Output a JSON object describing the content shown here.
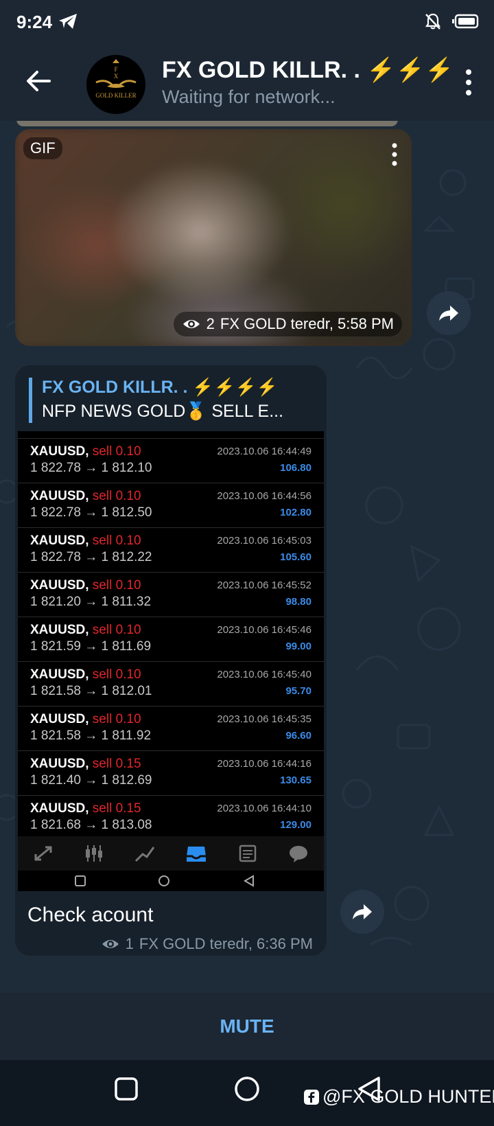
{
  "status_bar": {
    "time": "9:24"
  },
  "header": {
    "title": "FX GOLD KILLR. . ⚡⚡⚡",
    "subtitle": "Waiting for network..."
  },
  "gif_message": {
    "badge": "GIF",
    "views": "2",
    "signature": "FX GOLD teredr, 5:58 PM"
  },
  "post": {
    "reply_title": "FX GOLD KILLR. . ⚡⚡⚡⚡",
    "reply_text": "NFP NEWS   GOLD🥇 SELL  E...",
    "caption": "Check acount",
    "views": "1",
    "signature": "FX GOLD teredr, 6:36 PM",
    "trades": [
      {
        "symbol": "XAUUSD,",
        "side": "sell 0.10",
        "prices": "1 822.78 → 1 812.10",
        "date": "2023.10.06 16:44:49",
        "profit": "106.80"
      },
      {
        "symbol": "XAUUSD,",
        "side": "sell 0.10",
        "prices": "1 822.78 → 1 812.50",
        "date": "2023.10.06 16:44:56",
        "profit": "102.80"
      },
      {
        "symbol": "XAUUSD,",
        "side": "sell 0.10",
        "prices": "1 822.78 → 1 812.22",
        "date": "2023.10.06 16:45:03",
        "profit": "105.60"
      },
      {
        "symbol": "XAUUSD,",
        "side": "sell 0.10",
        "prices": "1 821.20 → 1 811.32",
        "date": "2023.10.06 16:45:52",
        "profit": "98.80"
      },
      {
        "symbol": "XAUUSD,",
        "side": "sell 0.10",
        "prices": "1 821.59 → 1 811.69",
        "date": "2023.10.06 16:45:46",
        "profit": "99.00"
      },
      {
        "symbol": "XAUUSD,",
        "side": "sell 0.10",
        "prices": "1 821.58 → 1 812.01",
        "date": "2023.10.06 16:45:40",
        "profit": "95.70"
      },
      {
        "symbol": "XAUUSD,",
        "side": "sell 0.10",
        "prices": "1 821.58 → 1 811.92",
        "date": "2023.10.06 16:45:35",
        "profit": "96.60"
      },
      {
        "symbol": "XAUUSD,",
        "side": "sell 0.15",
        "prices": "1 821.40 → 1 812.69",
        "date": "2023.10.06 16:44:16",
        "profit": "130.65"
      },
      {
        "symbol": "XAUUSD,",
        "side": "sell 0.15",
        "prices": "1 821.68 → 1 813.08",
        "date": "2023.10.06 16:44:10",
        "profit": "129.00"
      }
    ]
  },
  "mute_label": "MUTE",
  "watermark": "@FX GOLD HUNTER",
  "colors": {
    "accent": "#6ab3f3",
    "sell": "#e0262b",
    "profit": "#3b8be8"
  }
}
